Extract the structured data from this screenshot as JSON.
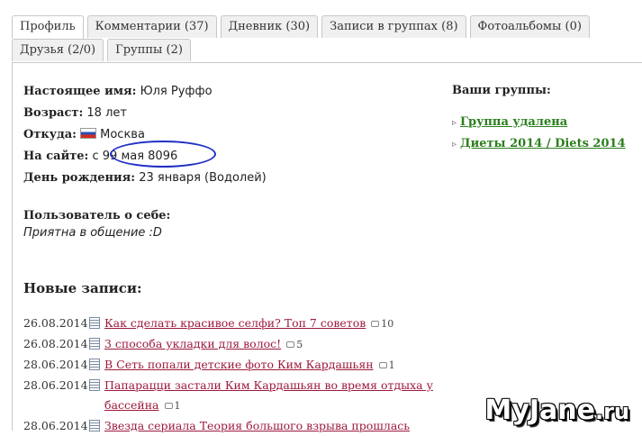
{
  "tabs": {
    "row1": [
      {
        "label": "Профиль",
        "active": true
      },
      {
        "label": "Комментарии (37)"
      },
      {
        "label": "Дневник (30)"
      },
      {
        "label": "Записи в группах (8)"
      },
      {
        "label": "Фотоальбомы (0)"
      }
    ],
    "row2": [
      {
        "label": "Друзья (2/0)"
      },
      {
        "label": "Группы (2)"
      }
    ]
  },
  "profile": {
    "real_name_label": "Настоящее имя:",
    "real_name": "Юля Руффо",
    "age_label": "Возраст:",
    "age": "18 лет",
    "from_label": "Откуда:",
    "from": "Москва",
    "flag_icon": "russia-flag-icon",
    "on_site_label": "На сайте:",
    "on_site": "с 99 мая 8096",
    "birthday_label": "День рождения:",
    "birthday": "23 января (Водолей)",
    "about_label": "Пользователь о себе:",
    "about": "Приятна в общение :D"
  },
  "groups": {
    "title": "Ваши группы:",
    "items": [
      {
        "label": "Группа удалена"
      },
      {
        "label": "Диеты 2014 / Diets 2014"
      }
    ]
  },
  "posts": {
    "title": "Новые записи:",
    "items": [
      {
        "date": "26.08.2014",
        "title": "Как сделать красивое селфи? Топ 7 советов",
        "comments": "10"
      },
      {
        "date": "26.08.2014",
        "title": "3 способа укладки для волос!",
        "comments": "5"
      },
      {
        "date": "28.06.2014",
        "title": "В Сеть попали детские фото Ким Кардашьян",
        "comments": "1"
      },
      {
        "date": "28.06.2014",
        "title": "Папарацци застали Ким Кардашьян во время отдыха у бассейна",
        "comments": "1"
      },
      {
        "date": "28.06.2014",
        "title": "Звезда сериала Теория большого взрыва прошлась",
        "comments": ""
      }
    ]
  },
  "watermark": {
    "main": "MyJane",
    "suffix": ".ru"
  },
  "colors": {
    "group_link": "#2a7f1c",
    "post_link": "#9c1a3c",
    "annotation_circle": "#1f2fc4"
  }
}
